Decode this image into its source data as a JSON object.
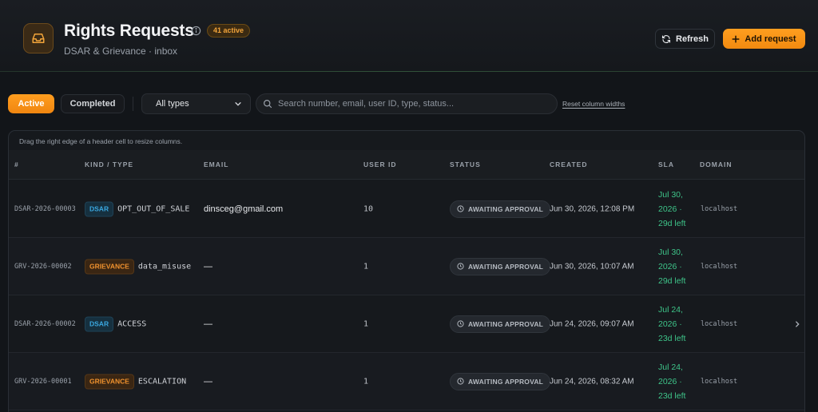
{
  "header": {
    "title": "Rights Requests",
    "active_badge": "41 active",
    "subtitle": "DSAR & Grievance · inbox",
    "refresh_label": "Refresh",
    "add_label": "Add request"
  },
  "toolbar": {
    "tab_active": "Active",
    "tab_completed": "Completed",
    "type_select_value": "All types",
    "search_placeholder": "Search number, email, user ID, type, status...",
    "reset_link": "Reset column widths"
  },
  "table": {
    "hint": "Drag the right edge of a header cell to resize columns.",
    "columns": [
      "#",
      "Kind / Type",
      "Email",
      "User ID",
      "Status",
      "Created",
      "SLA",
      "Domain"
    ],
    "rows": [
      {
        "num": "DSAR-2026-00003",
        "kind": "DSAR",
        "type": "OPT_OUT_OF_SALE",
        "email": "dinsceg@gmail.com",
        "user_id": "10",
        "status": "AWAITING APPROVAL",
        "created": "Jun 30, 2026, 12:08 PM",
        "sla": "Jul 30, 2026 · 29d left",
        "domain": "localhost"
      },
      {
        "num": "GRV-2026-00002",
        "kind": "GRIEVANCE",
        "type": "data_misuse",
        "email": "—",
        "user_id": "1",
        "status": "AWAITING APPROVAL",
        "created": "Jun 30, 2026, 10:07 AM",
        "sla": "Jul 30, 2026 · 29d left",
        "domain": "localhost"
      },
      {
        "num": "DSAR-2026-00002",
        "kind": "DSAR",
        "type": "ACCESS",
        "email": "—",
        "user_id": "1",
        "status": "AWAITING APPROVAL",
        "created": "Jun 24, 2026, 09:07 AM",
        "sla": "Jul 24, 2026 · 23d left",
        "domain": "localhost"
      },
      {
        "num": "GRV-2026-00001",
        "kind": "GRIEVANCE",
        "type": "ESCALATION",
        "email": "—",
        "user_id": "1",
        "status": "AWAITING APPROVAL",
        "created": "Jun 24, 2026, 08:32 AM",
        "sla": "Jul 24, 2026 · 23d left",
        "domain": "localhost"
      }
    ]
  },
  "colors": {
    "accent": "#f59a1c",
    "dsar": "#3aa8e0",
    "grievance": "#f0922e",
    "sla_ok": "#3ec489"
  },
  "icons": [
    "inbox-icon",
    "info-icon",
    "refresh-icon",
    "plus-icon",
    "chevron-down-icon",
    "search-icon",
    "clock-icon",
    "chevron-right-icon"
  ]
}
